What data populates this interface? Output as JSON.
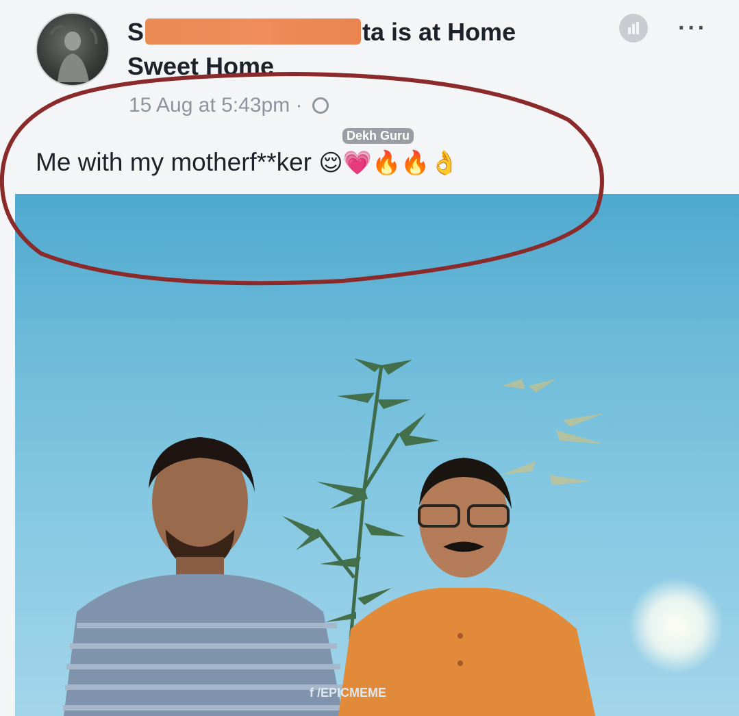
{
  "post": {
    "author_prefix": "S",
    "author_suffix": "ta is at Home",
    "location_line2": "Sweet Home",
    "timestamp": "15 Aug at 5:43pm",
    "separator": "·",
    "text": "Me with my motherf**ker",
    "emojis": "😌💗🔥🔥👌",
    "more_label": "···"
  },
  "watermarks": {
    "top": "Dekh Guru",
    "bottom": "f /EPICMEME"
  },
  "colors": {
    "redaction": "#f08d5a",
    "annotation_circle": "#8b2a2a",
    "text": "#1d2129",
    "meta": "#8d949e"
  },
  "icons": {
    "audience": "friends-icon",
    "privacy": "globe-icon",
    "more": "more-dots-icon"
  }
}
